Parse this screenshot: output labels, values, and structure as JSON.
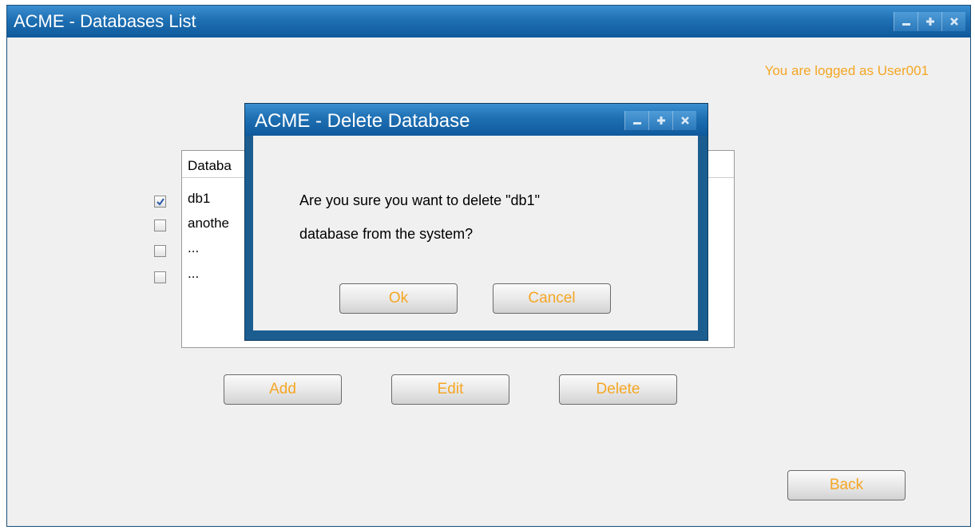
{
  "window": {
    "title": "ACME - Databases List",
    "controls": [
      "minimize-icon",
      "maximize-icon",
      "close-icon"
    ]
  },
  "user": {
    "logged_label": "You are logged as User001"
  },
  "db_list": {
    "header": "Databa",
    "rows": [
      {
        "label": "db1",
        "checked": true
      },
      {
        "label": "anothe",
        "checked": false
      },
      {
        "label": "...",
        "checked": false
      },
      {
        "label": "...",
        "checked": false
      }
    ]
  },
  "actions": {
    "add_label": "Add",
    "edit_label": "Edit",
    "delete_label": "Delete",
    "back_label": "Back"
  },
  "dialog": {
    "title": "ACME - Delete Database",
    "message_line1": "Are you sure you want to delete \"db1\"",
    "message_line2": "database from the system?",
    "ok_label": "Ok",
    "cancel_label": "Cancel"
  },
  "colors": {
    "accent_text": "#f5a623",
    "titlebar": "#1e6fb3",
    "dialog_frame": "#1c5d90"
  }
}
